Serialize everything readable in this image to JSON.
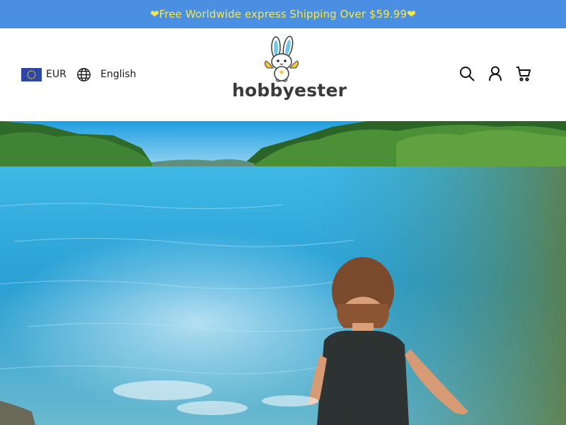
{
  "announcement": {
    "text": "❤Free Worldwide express Shipping Over $59.99❤"
  },
  "header": {
    "currency": {
      "code": "EUR",
      "flag_icon": "eu-flag-icon"
    },
    "language": {
      "label": "English",
      "icon": "globe-icon"
    },
    "logo": {
      "text": "hobbyester",
      "mascot_icon": "bunny-mascot-icon"
    },
    "actions": [
      {
        "name": "search",
        "icon": "search-icon"
      },
      {
        "name": "account",
        "icon": "user-icon"
      },
      {
        "name": "cart",
        "icon": "cart-icon"
      }
    ]
  },
  "hero": {
    "image": "lake-child-photo"
  },
  "colors": {
    "announcement_bg": "#4a8fe2",
    "announcement_text": "#f6e94a",
    "text": "#1b1b1b",
    "logo_text": "#3a3a3a"
  }
}
